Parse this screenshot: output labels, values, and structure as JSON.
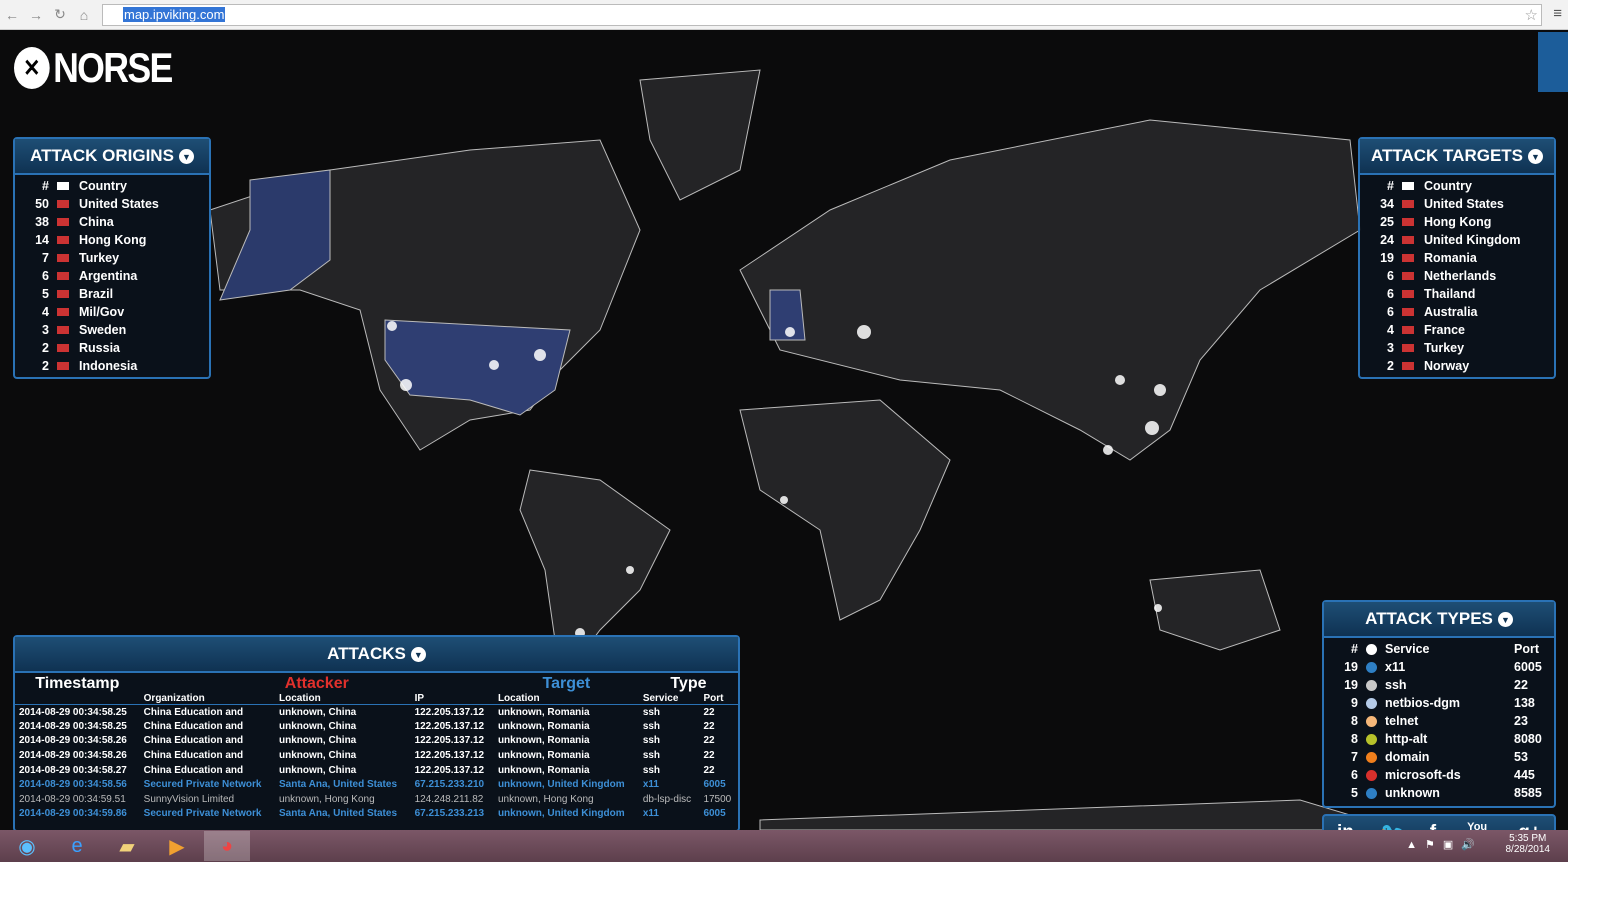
{
  "browser": {
    "url": "map.ipviking.com"
  },
  "brand": "NORSE",
  "origins": {
    "title": "ATTACK ORIGINS",
    "headers": {
      "num": "#",
      "country": "Country"
    },
    "rows": [
      {
        "n": "50",
        "c": "United States"
      },
      {
        "n": "38",
        "c": "China"
      },
      {
        "n": "14",
        "c": "Hong Kong"
      },
      {
        "n": "7",
        "c": "Turkey"
      },
      {
        "n": "6",
        "c": "Argentina"
      },
      {
        "n": "5",
        "c": "Brazil"
      },
      {
        "n": "4",
        "c": "Mil/Gov"
      },
      {
        "n": "3",
        "c": "Sweden"
      },
      {
        "n": "2",
        "c": "Russia"
      },
      {
        "n": "2",
        "c": "Indonesia"
      }
    ]
  },
  "targets": {
    "title": "ATTACK TARGETS",
    "headers": {
      "num": "#",
      "country": "Country"
    },
    "rows": [
      {
        "n": "34",
        "c": "United States"
      },
      {
        "n": "25",
        "c": "Hong Kong"
      },
      {
        "n": "24",
        "c": "United Kingdom"
      },
      {
        "n": "19",
        "c": "Romania"
      },
      {
        "n": "6",
        "c": "Netherlands"
      },
      {
        "n": "6",
        "c": "Thailand"
      },
      {
        "n": "6",
        "c": "Australia"
      },
      {
        "n": "4",
        "c": "France"
      },
      {
        "n": "3",
        "c": "Turkey"
      },
      {
        "n": "2",
        "c": "Norway"
      }
    ]
  },
  "types": {
    "title": "ATTACK TYPES",
    "headers": {
      "num": "#",
      "service": "Service",
      "port": "Port"
    },
    "rows": [
      {
        "n": "19",
        "s": "x11",
        "p": "6005",
        "color": "#2e7fc4"
      },
      {
        "n": "19",
        "s": "ssh",
        "p": "22",
        "color": "#c8c8c8"
      },
      {
        "n": "9",
        "s": "netbios-dgm",
        "p": "138",
        "color": "#b5cbe8"
      },
      {
        "n": "8",
        "s": "telnet",
        "p": "23",
        "color": "#f5b779"
      },
      {
        "n": "8",
        "s": "http-alt",
        "p": "8080",
        "color": "#b7c22a"
      },
      {
        "n": "7",
        "s": "domain",
        "p": "53",
        "color": "#f07f1c"
      },
      {
        "n": "6",
        "s": "microsoft-ds",
        "p": "445",
        "color": "#d8302c"
      },
      {
        "n": "5",
        "s": "unknown",
        "p": "8585",
        "color": "#2e7fc4"
      }
    ]
  },
  "social": [
    "in",
    "🐦",
    "f",
    "You Tube",
    "g+"
  ],
  "attacks": {
    "title": "ATTACKS",
    "groups": {
      "timestamp": "Timestamp",
      "attacker": "Attacker",
      "target": "Target",
      "type": "Type"
    },
    "cols": [
      "Organization",
      "Location",
      "IP",
      "Location",
      "Service",
      "Port"
    ],
    "rows": [
      [
        "2014-08-29  00:34:58.25",
        "China Education and",
        "unknown, China",
        "122.205.137.12",
        "unknown, Romania",
        "ssh",
        "22"
      ],
      [
        "2014-08-29  00:34:58.25",
        "China Education and",
        "unknown, China",
        "122.205.137.12",
        "unknown, Romania",
        "ssh",
        "22"
      ],
      [
        "2014-08-29  00:34:58.26",
        "China Education and",
        "unknown, China",
        "122.205.137.12",
        "unknown, Romania",
        "ssh",
        "22"
      ],
      [
        "2014-08-29  00:34:58.26",
        "China Education and",
        "unknown, China",
        "122.205.137.12",
        "unknown, Romania",
        "ssh",
        "22"
      ],
      [
        "2014-08-29  00:34:58.27",
        "China Education and",
        "unknown, China",
        "122.205.137.12",
        "unknown, Romania",
        "ssh",
        "22"
      ],
      [
        "2014-08-29  00:34:58.56",
        "Secured Private Network",
        "Santa Ana, United States",
        "67.215.233.210",
        "unknown, United Kingdom",
        "x11",
        "6005"
      ],
      [
        "2014-08-29  00:34:59.51",
        "SunnyVision Limited",
        "unknown, Hong Kong",
        "124.248.211.82",
        "unknown, Hong Kong",
        "db-lsp-disc",
        "17500"
      ],
      [
        "2014-08-29  00:34:59.86",
        "Secured Private Network",
        "Santa Ana, United States",
        "67.215.233.213",
        "unknown, United Kingdom",
        "x11",
        "6005"
      ]
    ],
    "row_styles": [
      "",
      "",
      "",
      "",
      "",
      "blue",
      "gray",
      "blue"
    ]
  },
  "taskbar": {
    "time": "5:35 PM",
    "date": "8/28/2014"
  }
}
